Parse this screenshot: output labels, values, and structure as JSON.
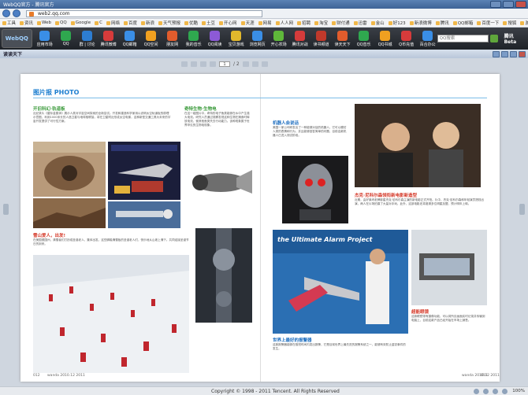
{
  "window": {
    "title": "WebQQ官方 - 腾讯官方"
  },
  "address": {
    "url": "web2.qq.com"
  },
  "favorites": [
    "工具",
    "资讯",
    "Web",
    "QQ",
    "Google",
    "C",
    "网络",
    "百度",
    "新浪",
    "天气预报",
    "优酷",
    "土豆",
    "开心网",
    "天涯",
    "网易",
    "人人网",
    "招聘",
    "淘宝",
    "财付通",
    "迅雷",
    "金山",
    "好123",
    "新浪微博",
    "腾讯",
    "QQ邮箱",
    "百度一下",
    "搜狐",
    "游戏",
    "Google 设置",
    "Google 图片"
  ],
  "qq_toolbar": {
    "logo": "WebQQ",
    "tools": [
      "应用市场",
      "QQ",
      "群 | 讨论",
      "腾讯微博",
      "QQ邮箱",
      "QQ空间",
      "朋友网",
      "我的音乐",
      "QQ阅读",
      "宝贝游戏",
      "浏览网页",
      "开心农场",
      "腾讯对战",
      "读书频道",
      "读天天下",
      "QQ音乐",
      "QQ书城",
      "Q币充值",
      "百合办公"
    ],
    "search_placeholder": "QQ搜索",
    "user": "腾讯Beta"
  },
  "reader": {
    "title": "读读天下",
    "page_current": "1",
    "page_total": "/ 2"
  },
  "magazine": {
    "section_title": "图片报 PHOTO",
    "left": {
      "h1": "开旧科幻·轨道板",
      "p1": "近纪录片《星际金属体》展示人类对宇宙空间探索的全新尝试。开发和建造科学家用以说明太空轨道板的原理示意图，利用1000米长的人造卫星与地球相联接，将在卫星附近形成太空电梯，这种新型交通工具为未来的宇宙开发提供了可行性方案。",
      "h2": "奇特生物·生物电",
      "p2": "在这一组图片中，奇特的电子鱼类能够在水中产生强大电流。研究人员通过观察发现这种生物在捕食时释放电流，使其他鱼类失去行动能力。该种现象属于世界罕见的生物电现象。",
      "h3": "雪山爱人，出发!",
      "p3": "在美国德国州，清雪者们打扮成圣诞老人，集体出发。这些脚踏滑雪板的圣诞老人们，快乐地从山坡上滑下。共同迎接圣诞节日的到来。",
      "page_no": "012",
      "page_label": "wanda 2010.12 2011"
    },
    "right": {
      "h1": "机器人会说话",
      "p1": "美国一家公司研发出了一种能够对话的机器人，它可以模仿人类的表情和行为，并且能够回答简单的问题，目前这款机器人已进入测试阶段。",
      "h2": "杰克·尼科尔森领衔新电影新造型",
      "p2": "近期，由好莱坞老牌影星杰克·尼科尔森主演的新电影正式开拍。片中，杰克·尼科尔森和年轻演员搭档出演，两人在片场拍摄了大量对手戏。此外，这部电影还将邀请多位明星加盟，预计明年上映。",
      "h3": "世界上最好的报警器",
      "p3": "这款报警器能够在极短时间内发出报警，它是目前世界上最先进的报警系统之一，能够有效防止盗窃事件的发生。",
      "h4": "超能眼镜",
      "p4": "这款眼镜带有摄像功能，可以将所见画面实时记录并传输到电脑上，目前这款产品已经开始在市场上销售。",
      "banner": "the Ultimate Alarm Project",
      "page_no": "013",
      "page_label": "wanda 2010.12 2011"
    }
  },
  "status": {
    "copyright": "Copyright © 1998 - 2011 Tencent. All Rights Reserved",
    "zoom": "100%"
  }
}
